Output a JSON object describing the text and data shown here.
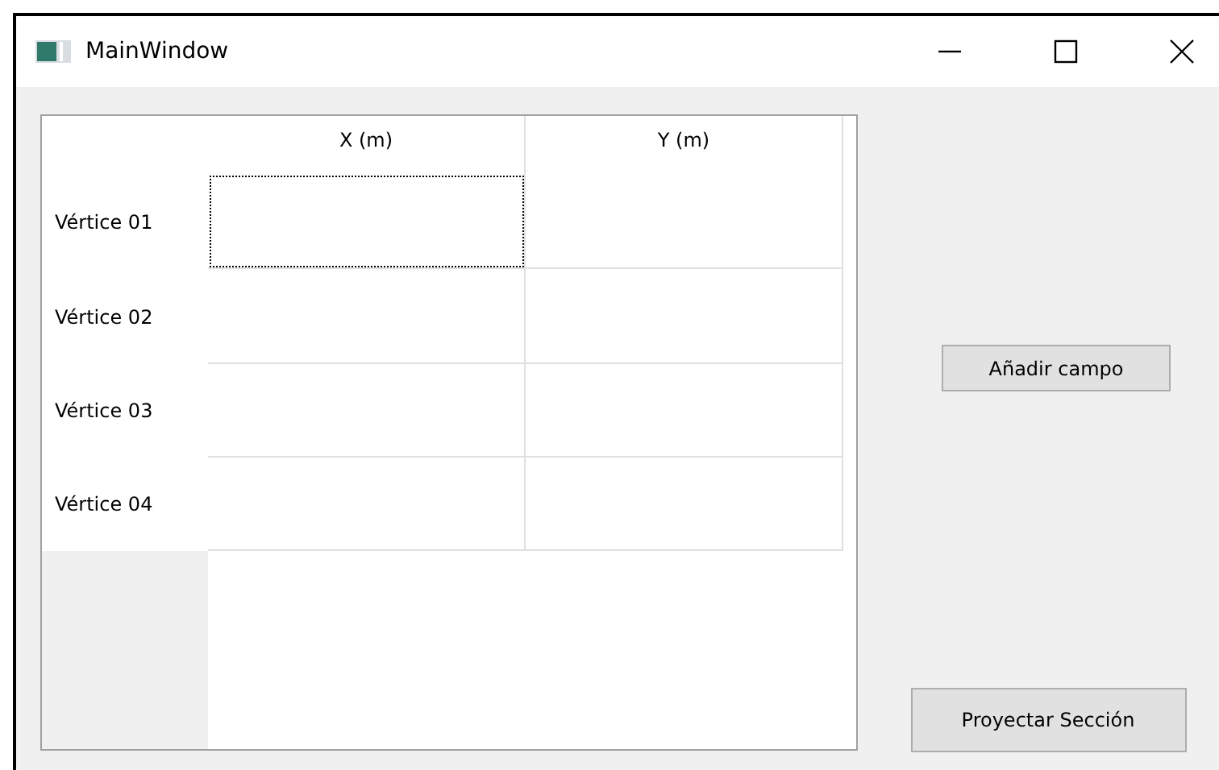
{
  "window": {
    "title": "MainWindow"
  },
  "table": {
    "columns": [
      "X (m)",
      "Y (m)"
    ],
    "rows": [
      {
        "header": "Vértice 01",
        "cells": [
          {
            "selected": true
          },
          {
            "selected": false
          }
        ]
      },
      {
        "header": "Vértice 02",
        "cells": [
          {
            "selected": false
          },
          {
            "selected": false
          }
        ]
      },
      {
        "header": "Vértice 03",
        "cells": [
          {
            "selected": false
          },
          {
            "selected": false
          }
        ]
      },
      {
        "header": "Vértice 04",
        "cells": [
          {
            "selected": false
          },
          {
            "selected": false
          }
        ]
      }
    ]
  },
  "buttons": [
    "Añadir campo",
    "Proyectar Sección"
  ]
}
